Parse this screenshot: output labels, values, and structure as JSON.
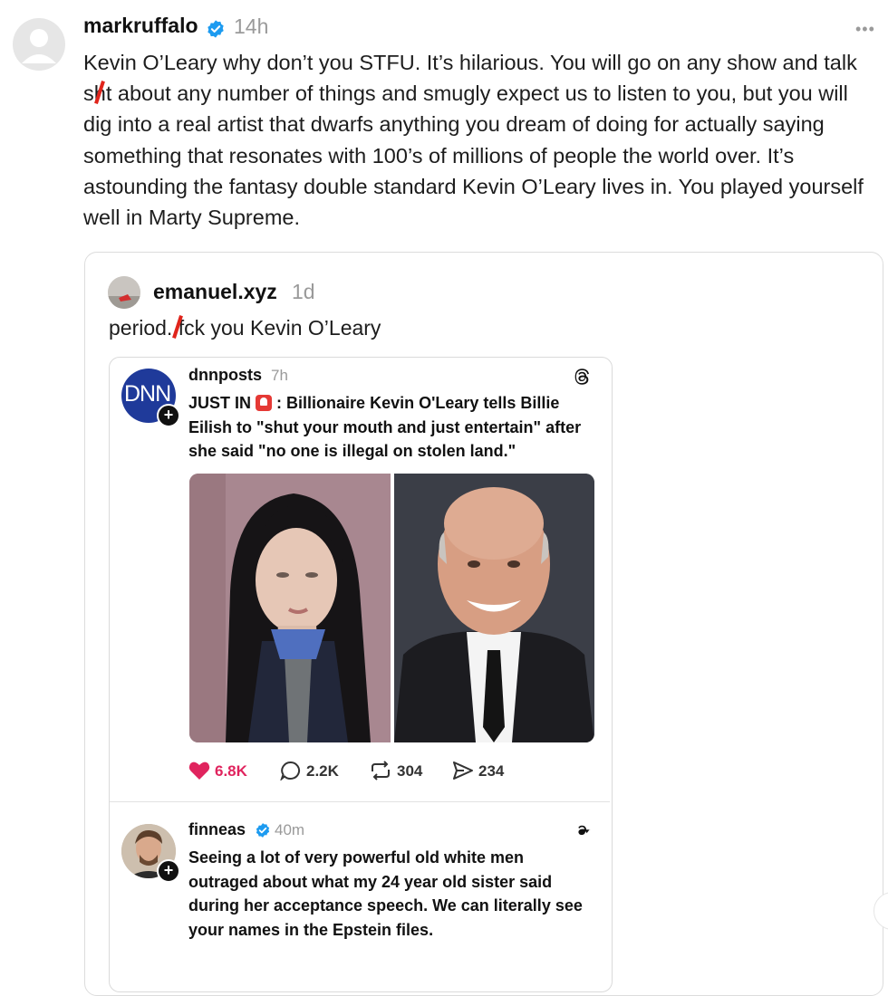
{
  "main_post": {
    "username": "markruffalo",
    "time": "14h",
    "more_label": "•••",
    "text_before_censor": "Kevin O’Leary why don’t you STFU. It’s hilarious. You will go on any show and talk sh",
    "text_after_censor": "t about any number of things and smugly expect us to listen to you, but you will dig into a real artist that dwarfs anything you dream of doing for actually saying something that resonates with 100’s of millions of people the world over. It’s astounding the fantasy double standard Kevin O’Leary lives in. You played yourself well in Marty Supreme."
  },
  "quoted_post": {
    "username": "emanuel.xyz",
    "time": "1d",
    "text_before_censor": "period. f",
    "text_after_censor": "ck you Kevin O’Leary"
  },
  "dnn_post": {
    "avatar_text": "DNN",
    "username": "dnnposts",
    "time": "7h",
    "text_prefix": "JUST IN",
    "text_body": ": Billionaire Kevin O'Leary tells Billie Eilish to \"shut your mouth and just entertain\" after she said \"no one is illegal on stolen land.\"",
    "stats": {
      "likes": "6.8K",
      "comments": "2.2K",
      "reposts": "304",
      "shares": "234"
    }
  },
  "finneas_post": {
    "username": "finneas",
    "time": "40m",
    "text": "Seeing a lot of very powerful old white men outraged about what my 24 year old sister said during her acceptance speech. We can literally see your names in the Epstein files."
  },
  "colors": {
    "verified_blue": "#1d9bf0",
    "like_red": "#e0245e",
    "censor_red": "#e0241b",
    "dnn_blue": "#1f3a9a"
  },
  "icons": [
    "verified-badge-icon",
    "more-icon",
    "threads-icon",
    "heart-icon",
    "comment-icon",
    "repost-icon",
    "share-icon",
    "plus-icon",
    "siren-emoji-icon"
  ]
}
